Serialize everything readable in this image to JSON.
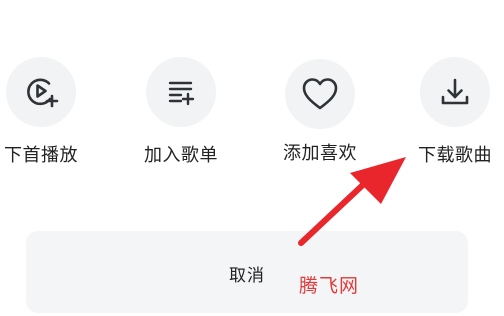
{
  "actions": [
    {
      "label": "下首播放",
      "icon": "play-next-icon"
    },
    {
      "label": "加入歌单",
      "icon": "add-to-playlist-icon"
    },
    {
      "label": "添加喜欢",
      "icon": "heart-icon"
    },
    {
      "label": "下载歌曲",
      "icon": "download-icon"
    }
  ],
  "cancel": {
    "label": "取消"
  },
  "watermark": {
    "text": "腾飞网"
  },
  "colors": {
    "icon": "#2f3337",
    "circle_bg": "#f2f3f4",
    "annotation_arrow": "#e8262c",
    "watermark": "#e03a3a"
  }
}
